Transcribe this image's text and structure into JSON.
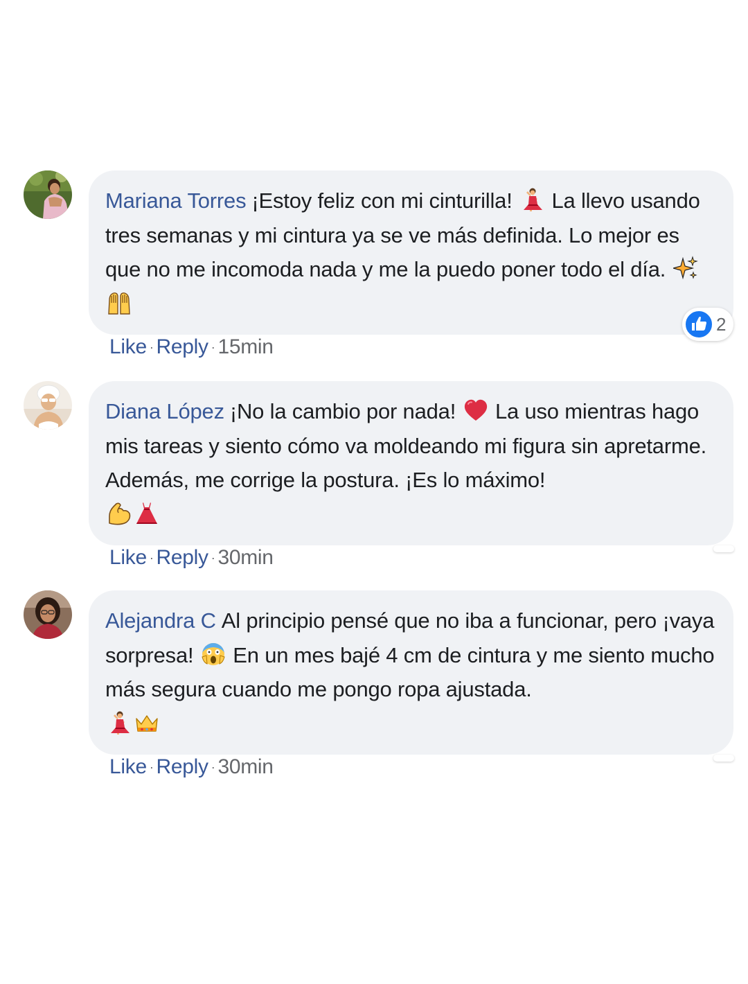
{
  "comments": [
    {
      "author": "Mariana Torres",
      "text1": "¡Estoy feliz con mi cinturilla!",
      "emoji1": "woman-dancing-emoji",
      "text2": "La llevo usando tres semanas y mi cintura ya se ve más definida. Lo mejor es que no me incomoda nada y me la puedo poner todo el día.",
      "emoji_end": [
        "sparkles-emoji",
        "raising-hands-emoji"
      ],
      "like_label": "Like",
      "reply_label": "Reply",
      "separator": "·",
      "time": "15min",
      "reaction_count": "2",
      "reaction_icon": "like-thumb-icon"
    },
    {
      "author": "Diana López",
      "text1": "¡No la cambio por nada!",
      "emoji1": "heart-emoji",
      "text2": "La uso mientras hago mis tareas y siento cómo va moldeando mi figura sin apretarme. Además, me corrige la postura. ¡Es lo máximo!",
      "emoji_end": [
        "flexed-biceps-emoji",
        "red-dress-emoji"
      ],
      "like_label": "Like",
      "reply_label": "Reply",
      "separator": "·",
      "time": "30min"
    },
    {
      "author": "Alejandra C",
      "text1": "Al principio pensé que no iba a funcionar, pero ¡vaya sorpresa!",
      "emoji1": "face-screaming-emoji",
      "text2": "En un mes bajé 4 cm de cintura y me siento mucho más segura cuando me pongo ropa ajustada.",
      "emoji_end": [
        "woman-dancing-emoji",
        "crown-emoji"
      ],
      "like_label": "Like",
      "reply_label": "Reply",
      "separator": "·",
      "time": "30min"
    }
  ],
  "colors": {
    "bubble_bg": "#f0f2f5",
    "author": "#385898",
    "meta": "#65676b",
    "like_blue": "#1877f2"
  }
}
